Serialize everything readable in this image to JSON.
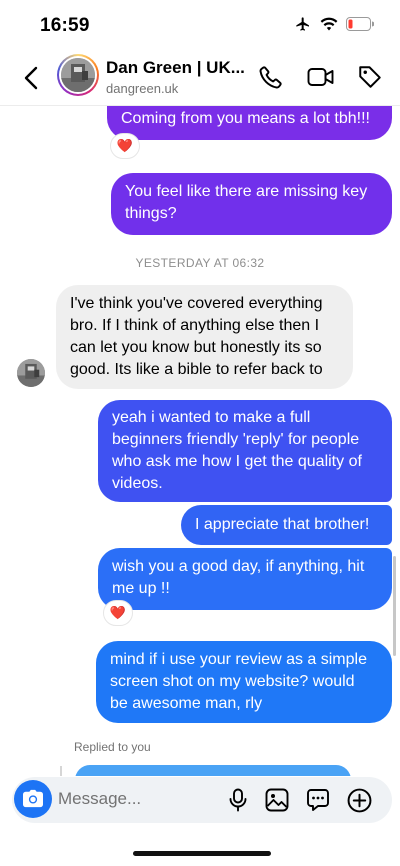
{
  "status": {
    "time": "16:59"
  },
  "header": {
    "name": "Dan Green | UK...",
    "handle": "dangreen.uk"
  },
  "messages": {
    "m1": {
      "line1": "Coming from you means a lot tbh!!!",
      "reaction": "❤️"
    },
    "m2": {
      "line1": "You feel like there are missing key",
      "line2": "things?"
    },
    "timestamp": "YESTERDAY AT 06:32",
    "m3": {
      "line1": "I've think you've covered everything",
      "line2": "bro. If I think of anything else then I",
      "line3": "can let you know but honestly its so",
      "line4": "good. Its like a bible to refer back to"
    },
    "m4": {
      "line1": "yeah i wanted to make a full",
      "line2": "beginners friendly 'reply' for people",
      "line3": "who ask me how I get the quality of",
      "line4": "videos."
    },
    "m5": {
      "line1": "I appreciate that brother!"
    },
    "m6": {
      "line1": "wish you a good day, if anything, hit",
      "line2": "me up !!",
      "reaction": "❤️"
    },
    "m7": {
      "line1": "mind if i use your review as a simple",
      "line2": "screen shot on my website? would",
      "line3": "be awesome man, rly"
    },
    "replied_label": "Replied to you"
  },
  "composer": {
    "placeholder": "Message..."
  },
  "colors": {
    "accent": "#1d74f5",
    "bubble_purple": "#7a2ee8",
    "bubble_blue": "#2b73f8",
    "incoming_bubble": "#efefef",
    "reaction_heart": "#e0245e"
  },
  "icons": {
    "status": [
      "airplane-icon",
      "wifi-icon",
      "battery-low-icon"
    ],
    "header": [
      "back-chevron-icon",
      "phone-icon",
      "video-icon",
      "tag-icon"
    ],
    "composer": [
      "camera-icon",
      "microphone-icon",
      "gallery-icon",
      "sticker-icon",
      "plus-circle-icon"
    ]
  }
}
